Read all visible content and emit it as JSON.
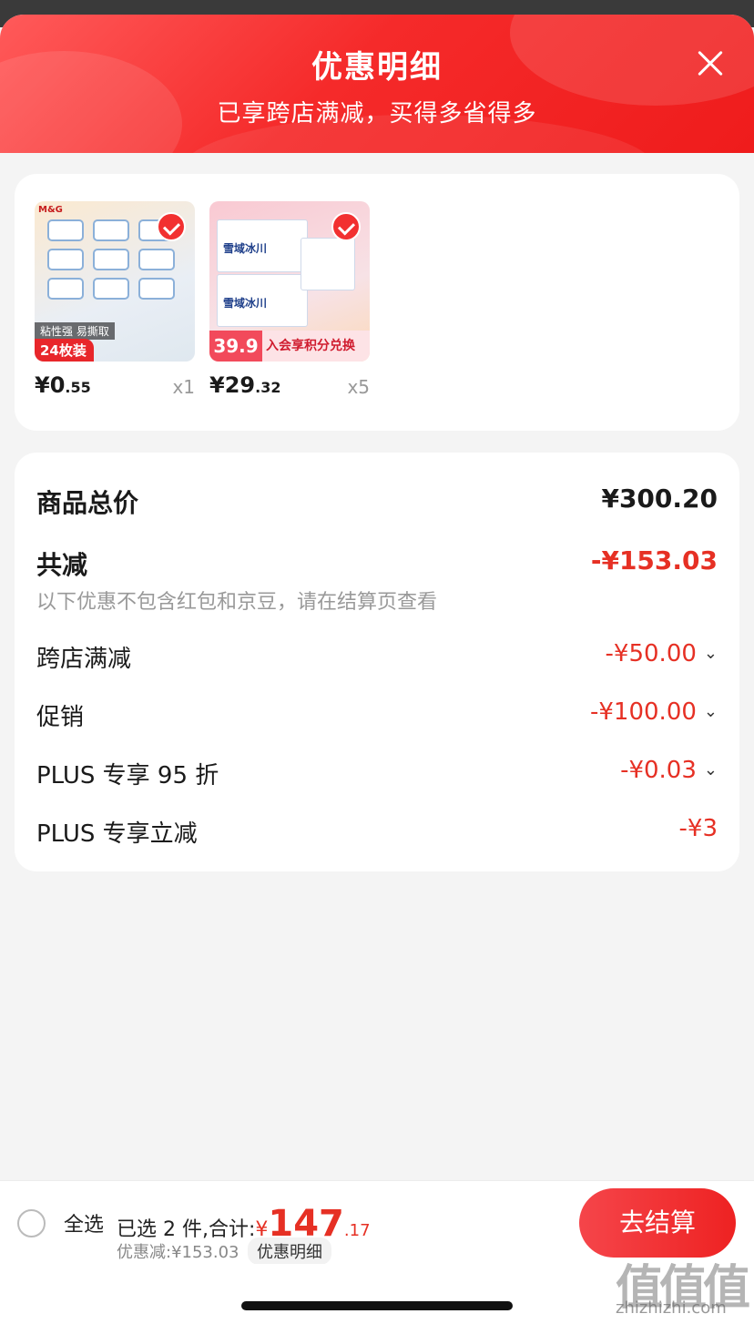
{
  "header": {
    "title": "优惠明细",
    "subtitle": "已享跨店满减，买得多省得多"
  },
  "products": [
    {
      "brand": "M&G",
      "tag_top": "粘性强 易撕取",
      "tag_main": "24枚装",
      "price_int": "¥0",
      "price_dec": ".55",
      "qty": "x1",
      "checked": true
    },
    {
      "box_label": "雪域冰川",
      "promo_price": "39.9",
      "promo_text": "入会享积分兑换",
      "price_int": "¥29",
      "price_dec": ".32",
      "qty": "x5",
      "checked": true
    }
  ],
  "summary": {
    "total_label": "商品总价",
    "total_value": "¥300.20",
    "reduce_label": "共减",
    "reduce_value": "-¥153.03",
    "note": "以下优惠不包含红包和京豆，请在结算页查看",
    "items": [
      {
        "label": "跨店满减",
        "value": "-¥50.00",
        "expandable": true
      },
      {
        "label": "促销",
        "value": "-¥100.00",
        "expandable": true
      },
      {
        "label": "PLUS 专享 95 折",
        "value": "-¥0.03",
        "expandable": true
      },
      {
        "label": "PLUS 专享立减",
        "value": "-¥3",
        "expandable": false
      }
    ]
  },
  "bottom_bar": {
    "select_all": "全选",
    "selected_prefix": "已选 2 件,合计:",
    "currency": "¥",
    "total_int": "147",
    "total_dec": ".17",
    "discount": "优惠减:¥153.03",
    "detail_link": "优惠明细",
    "checkout": "去结算"
  },
  "watermark": {
    "text": "值值值",
    "url": "zhizhizhi.com"
  },
  "colors": {
    "accent": "#f23030",
    "discount_red": "#e63024"
  }
}
